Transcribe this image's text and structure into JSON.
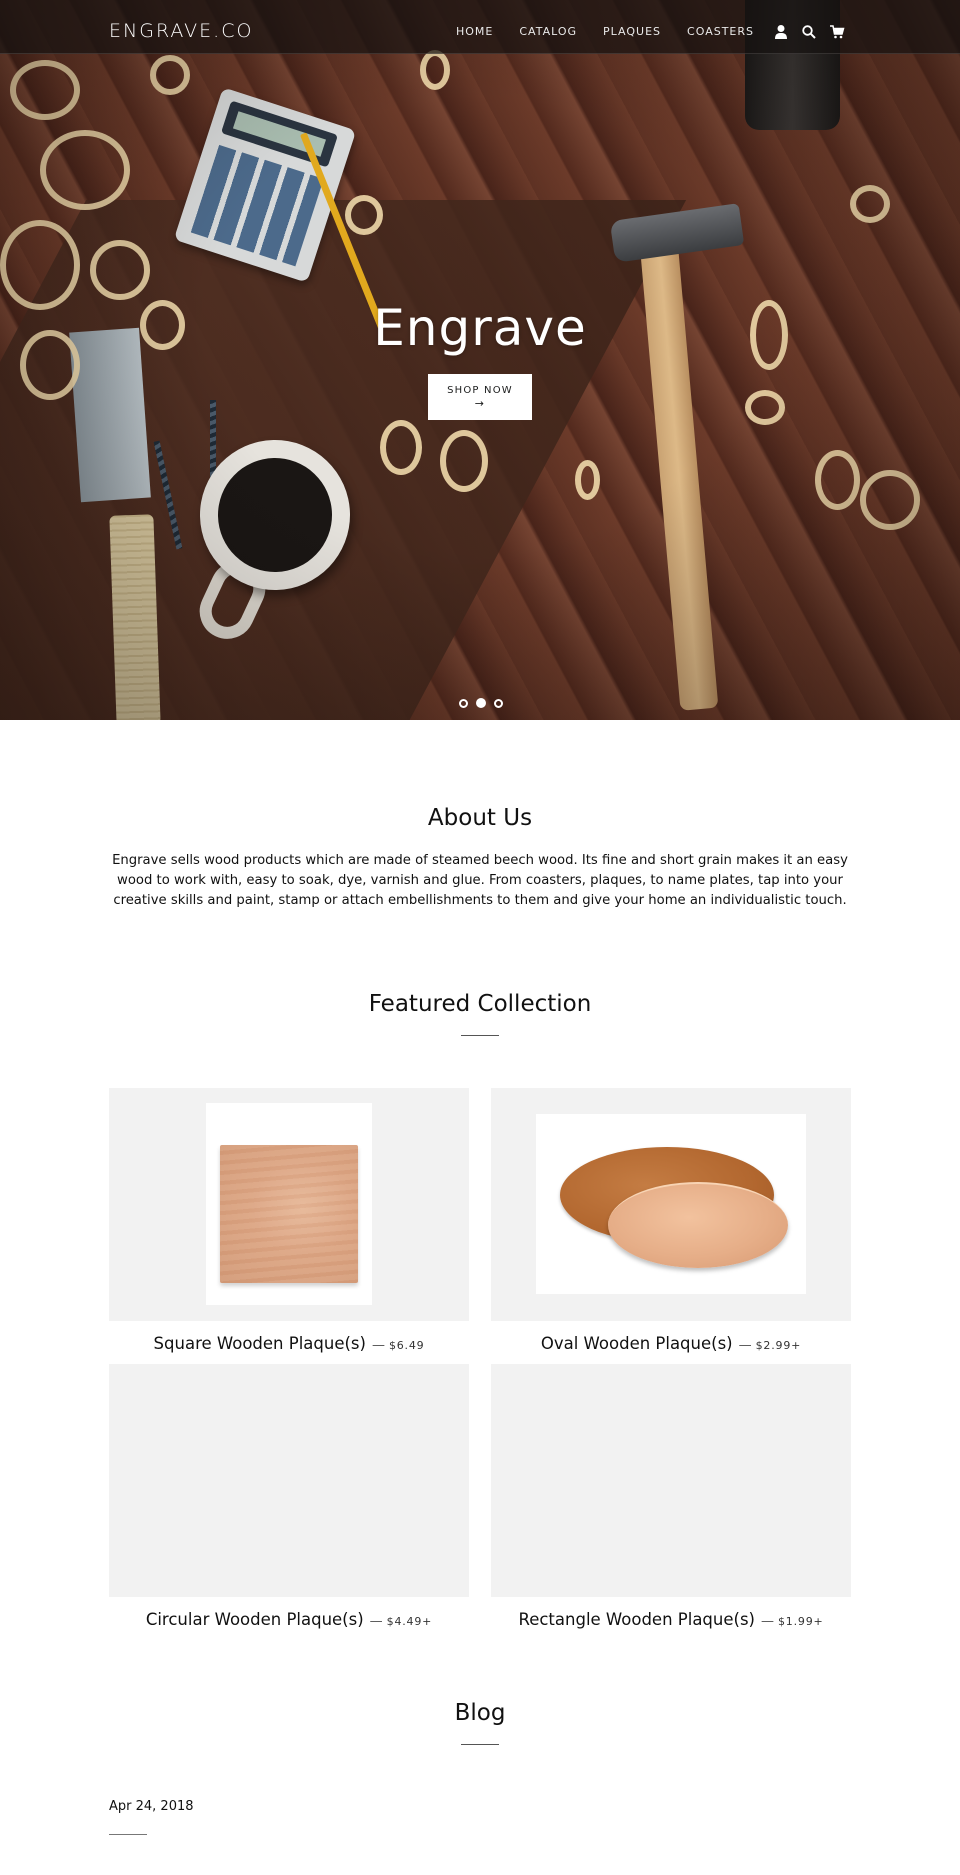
{
  "header": {
    "logo": "ENGRAVE.CO",
    "nav": [
      {
        "label": "HOME"
      },
      {
        "label": "CATALOG"
      },
      {
        "label": "PLAQUES"
      },
      {
        "label": "COASTERS"
      }
    ],
    "icons": [
      "account-icon",
      "search-icon",
      "cart-icon"
    ]
  },
  "hero": {
    "title": "Engrave",
    "button_label": "SHOP NOW",
    "button_arrow": "→",
    "slides": {
      "count": 3,
      "active_index": 1
    }
  },
  "about": {
    "title": "About Us",
    "text": "Engrave sells wood products which are made of steamed beech wood. Its fine and short grain makes it an easy wood to work with, easy to soak, dye, varnish and glue. From coasters, plaques, to name plates, tap into your creative skills and paint, stamp or attach embellishments to them and give your home an individualistic touch."
  },
  "featured": {
    "title": "Featured Collection",
    "products": [
      {
        "name": "Square Wooden Plaque(s)",
        "separator": "—",
        "price": "$6.49",
        "image": "square-plaque"
      },
      {
        "name": "Oval Wooden Plaque(s)",
        "separator": "—",
        "price": "$2.99+",
        "image": "oval-plaque"
      },
      {
        "name": "Circular Wooden Plaque(s)",
        "separator": "—",
        "price": "$4.49+",
        "image": ""
      },
      {
        "name": "Rectangle Wooden Plaque(s)",
        "separator": "—",
        "price": "$1.99+",
        "image": ""
      }
    ]
  },
  "blog": {
    "title": "Blog",
    "posts": [
      {
        "date": "Apr 24, 2018"
      }
    ]
  },
  "colors": {
    "header_bg": "#161211",
    "placeholder_bg": "#f2f2f2",
    "text": "#1c1d1d"
  }
}
